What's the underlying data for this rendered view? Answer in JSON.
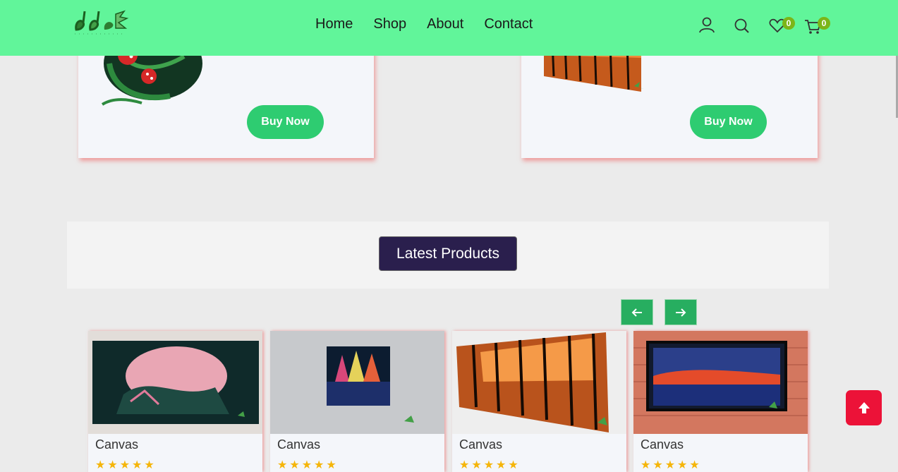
{
  "header": {
    "nav": [
      "Home",
      "Shop",
      "About",
      "Contact"
    ],
    "wishlist_count": "0",
    "cart_count": "0"
  },
  "top_cards": [
    {
      "buy_label": "Buy Now"
    },
    {
      "buy_label": "Buy Now"
    }
  ],
  "section": {
    "title": "Latest Products"
  },
  "products": [
    {
      "name": "Canvas",
      "stars": "★★★★★"
    },
    {
      "name": "Canvas",
      "stars": "★★★★★"
    },
    {
      "name": "Canvas",
      "stars": "★★★★★"
    },
    {
      "name": "Canvas",
      "stars": "★★★★★"
    }
  ],
  "colors": {
    "header_bg": "#61f59a",
    "buy_button": "#2ecc71",
    "title_bg": "#2a1f4d",
    "arrow_button": "#27ae60",
    "scroll_top": "#ec1238",
    "badge": "#7cb518"
  }
}
